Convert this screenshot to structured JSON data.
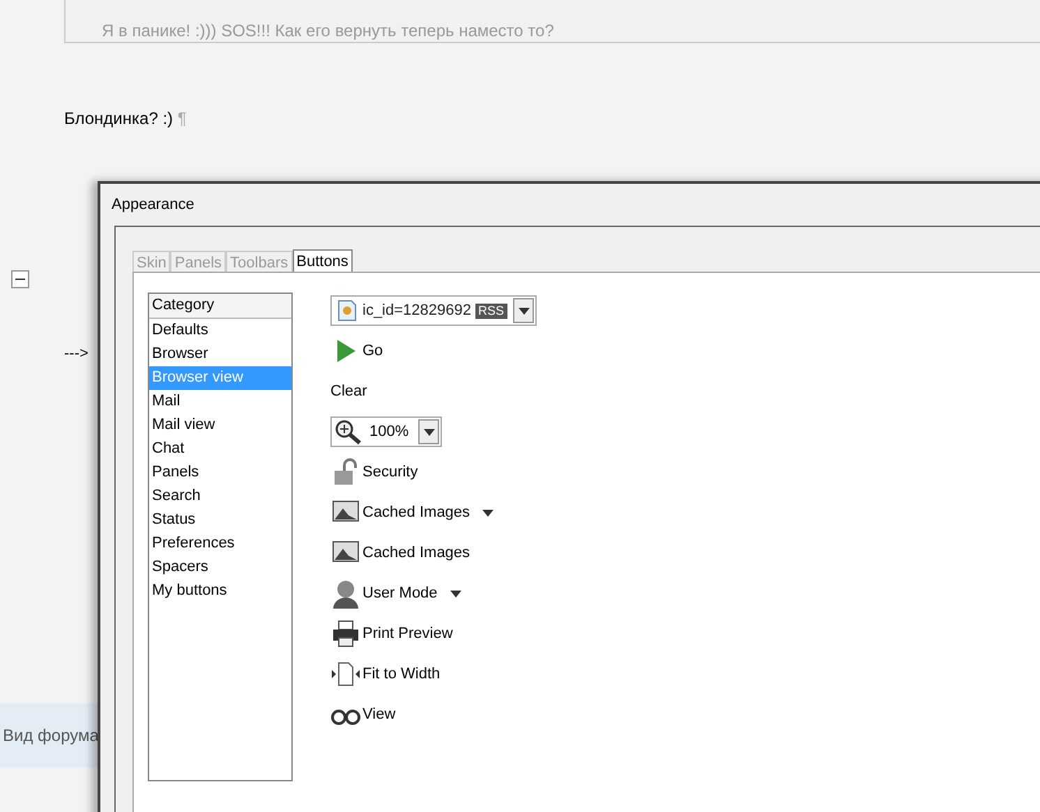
{
  "forum": {
    "quote_text": "Я в панике! :))) SOS!!! Как его вернуть теперь наместо то?",
    "post_text": "Блондинка? :)",
    "pilcrow": "¶",
    "arrow_text": "--->",
    "footer": "Вид форума"
  },
  "dialog": {
    "title": "Appearance",
    "tabs": [
      {
        "label": "Skin",
        "selected": false
      },
      {
        "label": "Panels",
        "selected": false
      },
      {
        "label": "Toolbars",
        "selected": false
      },
      {
        "label": "Buttons",
        "selected": true
      }
    ],
    "category_header": "Category",
    "categories": [
      {
        "label": "Defaults",
        "selected": false
      },
      {
        "label": "Browser",
        "selected": false
      },
      {
        "label": "Browser view",
        "selected": true
      },
      {
        "label": "Mail",
        "selected": false
      },
      {
        "label": "Mail view",
        "selected": false
      },
      {
        "label": "Chat",
        "selected": false
      },
      {
        "label": "Panels",
        "selected": false
      },
      {
        "label": "Search",
        "selected": false
      },
      {
        "label": "Status",
        "selected": false
      },
      {
        "label": "Preferences",
        "selected": false
      },
      {
        "label": "Spacers",
        "selected": false
      },
      {
        "label": "My buttons",
        "selected": false
      }
    ],
    "buttons": [
      {
        "kind": "address",
        "text": "ic_id=12829692",
        "badge": "RSS"
      },
      {
        "kind": "button",
        "label": "Go",
        "has_menu": false
      },
      {
        "kind": "text",
        "label": "Clear"
      },
      {
        "kind": "zoom",
        "text": "100%"
      },
      {
        "kind": "button",
        "label": "Security",
        "has_menu": false
      },
      {
        "kind": "button",
        "label": "Cached Images",
        "has_menu": true
      },
      {
        "kind": "button",
        "label": "Cached Images",
        "has_menu": false
      },
      {
        "kind": "button",
        "label": "User Mode",
        "has_menu": true
      },
      {
        "kind": "button",
        "label": "Print Preview",
        "has_menu": false
      },
      {
        "kind": "button",
        "label": "Fit to Width",
        "has_menu": false
      },
      {
        "kind": "button",
        "label": "View",
        "has_menu": false
      }
    ]
  }
}
